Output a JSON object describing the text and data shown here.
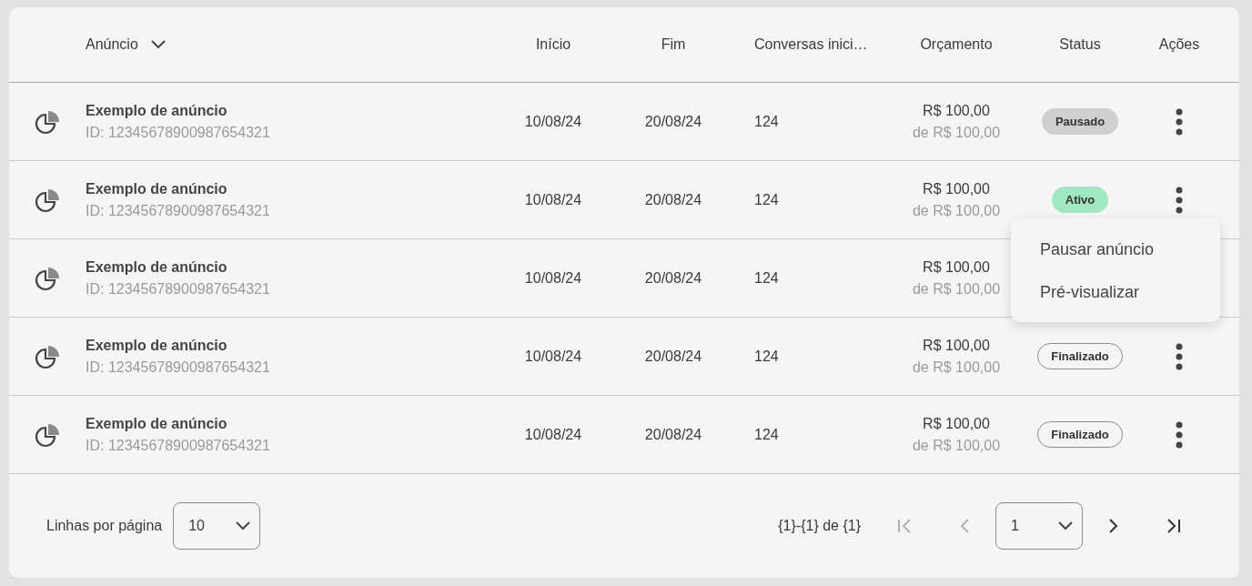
{
  "table": {
    "columns": [
      {
        "label": "Anúncio",
        "kind": "sortable"
      },
      {
        "label": "Início",
        "kind": "plain"
      },
      {
        "label": "Fim",
        "kind": "plain"
      },
      {
        "label": "Conversas inici…",
        "kind": "plain"
      },
      {
        "label": "Orçamento",
        "kind": "plain"
      },
      {
        "label": "Status",
        "kind": "plain"
      },
      {
        "label": "Ações",
        "kind": "plain"
      }
    ],
    "rows": [
      {
        "name": "Exemplo de anúncio",
        "id": "ID: 12345678900987654321",
        "start": "10/08/24",
        "end": "20/08/24",
        "conversations": "124",
        "budget": "R$ 100,00",
        "budget_total": "de R$ 100,00",
        "status": {
          "label": "Pausado",
          "kind": "paused"
        }
      },
      {
        "name": "Exemplo de anúncio",
        "id": "ID: 12345678900987654321",
        "start": "10/08/24",
        "end": "20/08/24",
        "conversations": "124",
        "budget": "R$ 100,00",
        "budget_total": "de R$ 100,00",
        "status": {
          "label": "Ativo",
          "kind": "active"
        }
      },
      {
        "name": "Exemplo de anúncio",
        "id": "ID: 12345678900987654321",
        "start": "10/08/24",
        "end": "20/08/24",
        "conversations": "124",
        "budget": "R$ 100,00",
        "budget_total": "de R$ 100,00"
      },
      {
        "name": "Exemplo de anúncio",
        "id": "ID: 12345678900987654321",
        "start": "10/08/24",
        "end": "20/08/24",
        "conversations": "124",
        "budget": "R$ 100,00",
        "budget_total": "de R$ 100,00",
        "status": {
          "label": "Finalizado",
          "kind": "finished"
        }
      },
      {
        "name": "Exemplo de anúncio",
        "id": "ID: 12345678900987654321",
        "start": "10/08/24",
        "end": "20/08/24",
        "conversations": "124",
        "budget": "R$ 100,00",
        "budget_total": "de R$ 100,00",
        "status": {
          "label": "Finalizado",
          "kind": "finished"
        }
      }
    ]
  },
  "action_menu": {
    "items": [
      "Pausar anúncio",
      "Pré-visualizar"
    ]
  },
  "pagination": {
    "rows_label": "Linhas por página",
    "rows_per_page": "10",
    "range": "{1}-{1} de {1}",
    "page": "1",
    "buttons": [
      {
        "kind": "first",
        "disabled": true
      },
      {
        "kind": "prev",
        "disabled": true
      },
      {
        "kind": "page_select",
        "disabled": false
      },
      {
        "kind": "next",
        "disabled": false
      },
      {
        "kind": "last",
        "disabled": false
      }
    ]
  }
}
